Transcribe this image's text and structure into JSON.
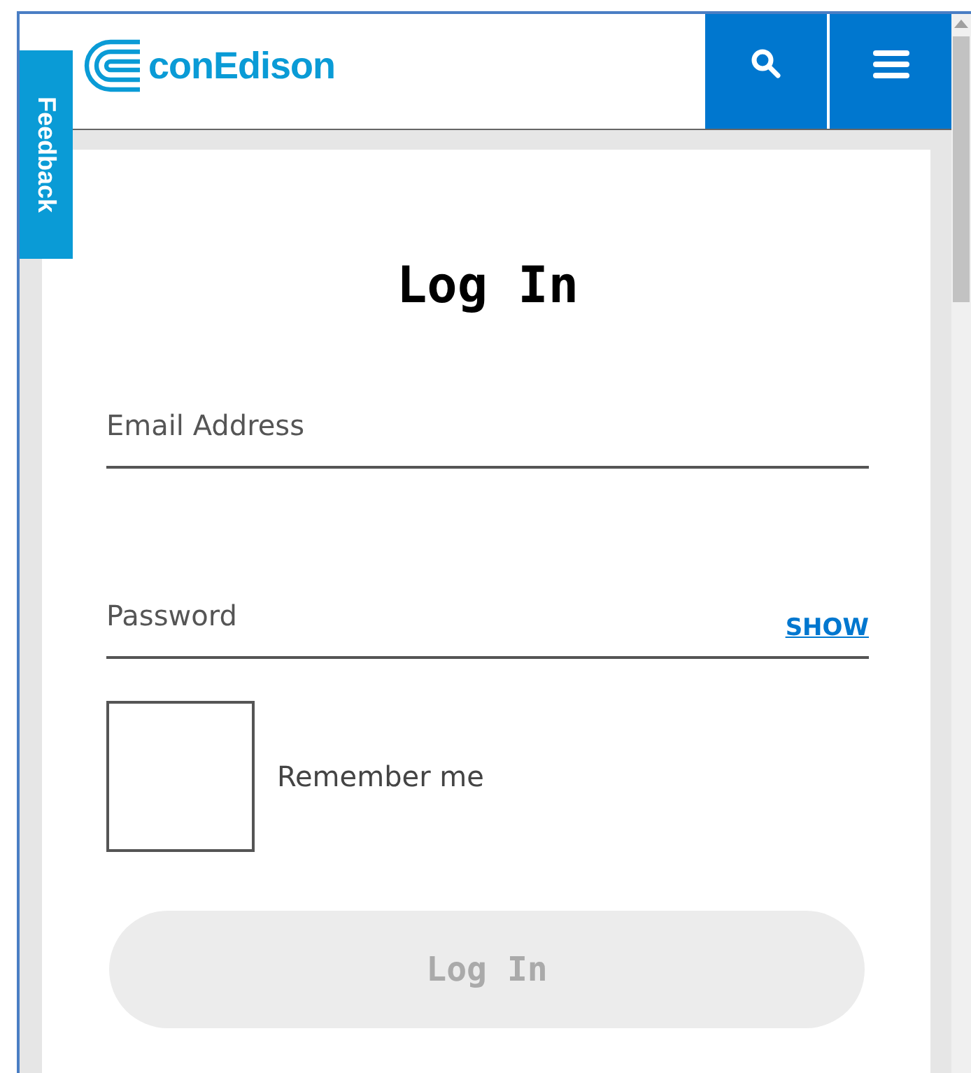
{
  "header": {
    "logo_text": "conEdison"
  },
  "feedback_tab": {
    "label": "Feedback"
  },
  "form": {
    "title": "Log In",
    "fields": [
      {
        "kind": "email",
        "placeholder": "Email Address"
      },
      {
        "kind": "password",
        "placeholder": "Password",
        "toggle": "SHOW"
      }
    ],
    "remember": {
      "label": "Remember me",
      "checked": false
    },
    "submit": {
      "label": "Log In",
      "disabled": true
    }
  }
}
